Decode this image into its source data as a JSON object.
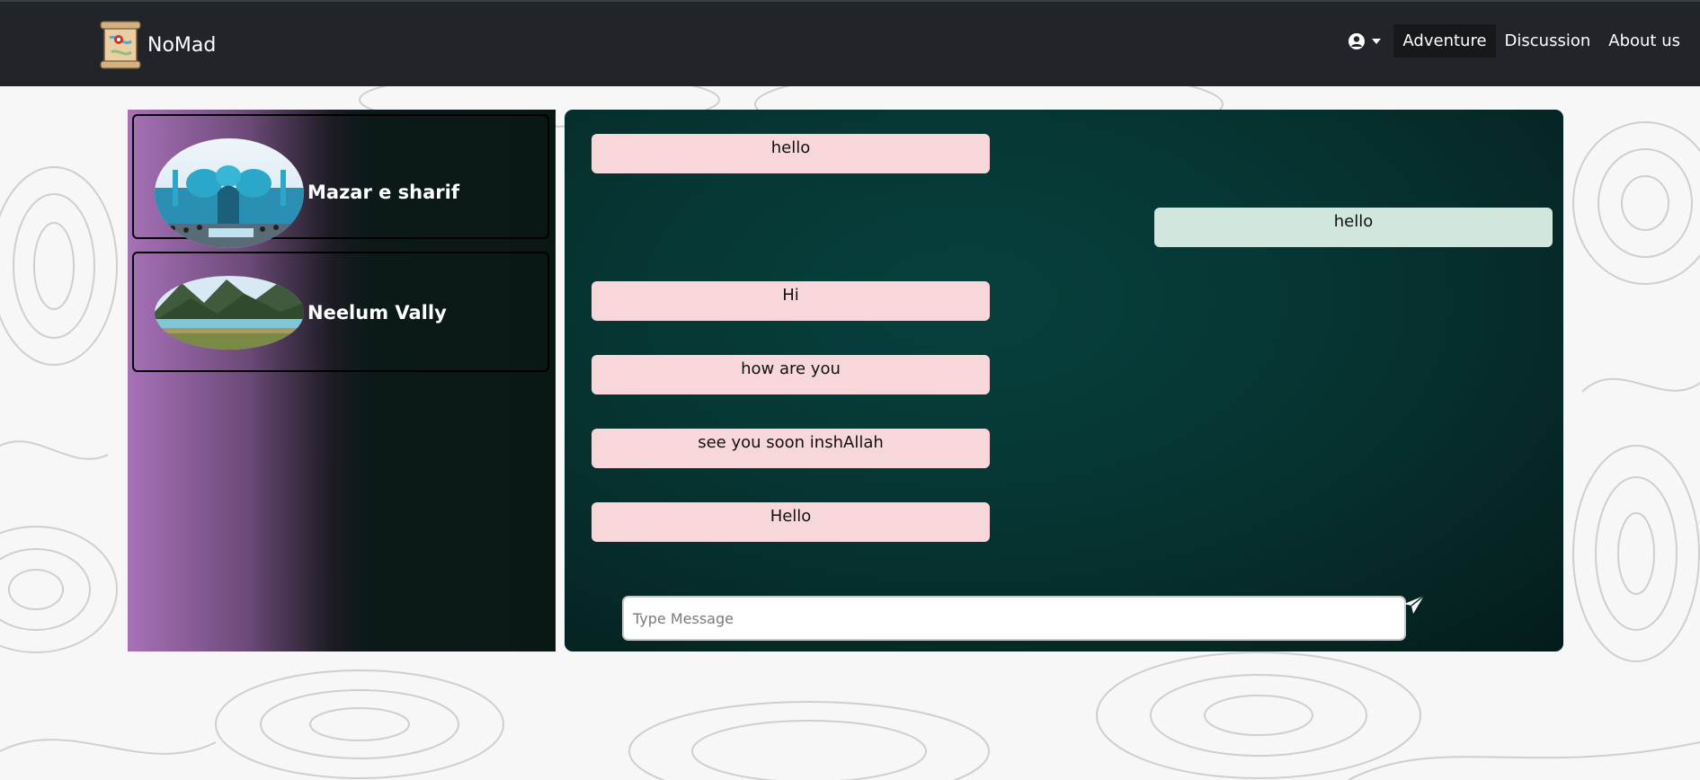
{
  "brand": {
    "name": "NoMad",
    "logo_icon": "map-scroll-icon"
  },
  "nav": {
    "user_icon": "user-circle-icon",
    "links": [
      {
        "label": "Adventure",
        "active": true
      },
      {
        "label": "Discussion",
        "active": false
      },
      {
        "label": "About us",
        "active": false
      }
    ]
  },
  "places": [
    {
      "name": "Mazar e sharif"
    },
    {
      "name": "Neelum Vally"
    }
  ],
  "messages": [
    {
      "text": "hello",
      "direction": "incoming"
    },
    {
      "text": "hello",
      "direction": "outgoing"
    },
    {
      "text": "Hi",
      "direction": "incoming"
    },
    {
      "text": "how are you",
      "direction": "incoming"
    },
    {
      "text": "see you soon inshAllah",
      "direction": "incoming"
    },
    {
      "text": "Hello",
      "direction": "incoming"
    }
  ],
  "composer": {
    "placeholder": "Type Message",
    "value": "",
    "send_icon": "paper-plane-icon"
  },
  "colors": {
    "navbar": "#212529",
    "incoming_bubble": "#f8d7da",
    "outgoing_bubble": "#d1e7dd",
    "chat_bg": "#063835"
  }
}
